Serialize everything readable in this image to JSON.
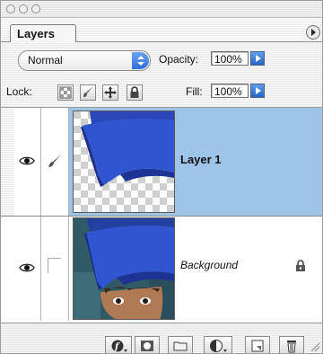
{
  "panel": {
    "tab_label": "Layers"
  },
  "options": {
    "blend_mode": "Normal",
    "opacity_label": "Opacity:",
    "opacity_value": "100%",
    "lock_label": "Lock:",
    "fill_label": "Fill:",
    "fill_value": "100%"
  },
  "layers": [
    {
      "name": "Layer 1",
      "selected": true,
      "visible": true
    },
    {
      "name": "Background",
      "selected": false,
      "visible": true,
      "locked": true
    }
  ],
  "toolbar": {
    "buttons": [
      "layer-style-icon",
      "mask-icon",
      "folder-icon",
      "adjustment-icon",
      "new-layer-icon",
      "trash-icon"
    ]
  },
  "colors": {
    "selection": "#9ec4e8",
    "accent_blue": "#2f6fd9"
  }
}
